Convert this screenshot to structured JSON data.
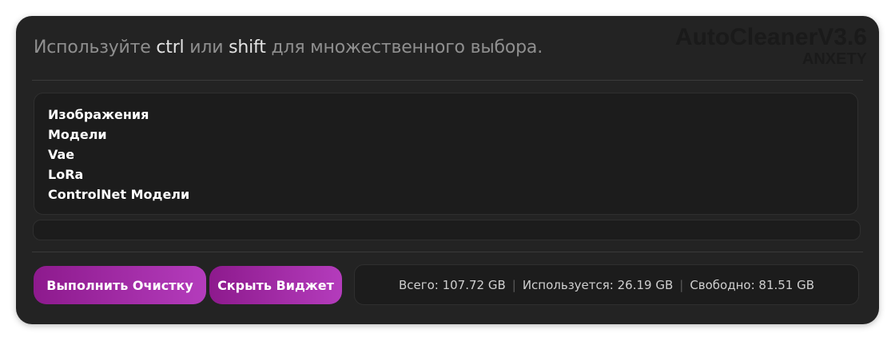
{
  "header": {
    "hint_prefix": "Используйте",
    "key_ctrl": "ctrl",
    "hint_or": "или",
    "key_shift": "shift",
    "hint_suffix": "для множественного выбора.",
    "brand_title": "AutoCleanerV3.6",
    "brand_subtitle": "ANXETY"
  },
  "options": [
    "Изображения",
    "Модели",
    "Vae",
    "LoRa",
    "ControlNet Модели"
  ],
  "progress": {
    "value_percent": 0
  },
  "buttons": {
    "execute_label": "Выполнить Очистку",
    "hide_label": "Скрыть Виджет"
  },
  "storage": {
    "total": "Всего: 107.72 GB",
    "used": "Используется: 26.19 GB",
    "free": "Свободно: 81.51 GB",
    "separator": "|"
  },
  "colors": {
    "panel_bg": "#232323",
    "accent_start": "#8d1a8d",
    "accent_end": "#b43cbc",
    "text": "#ffffff"
  }
}
